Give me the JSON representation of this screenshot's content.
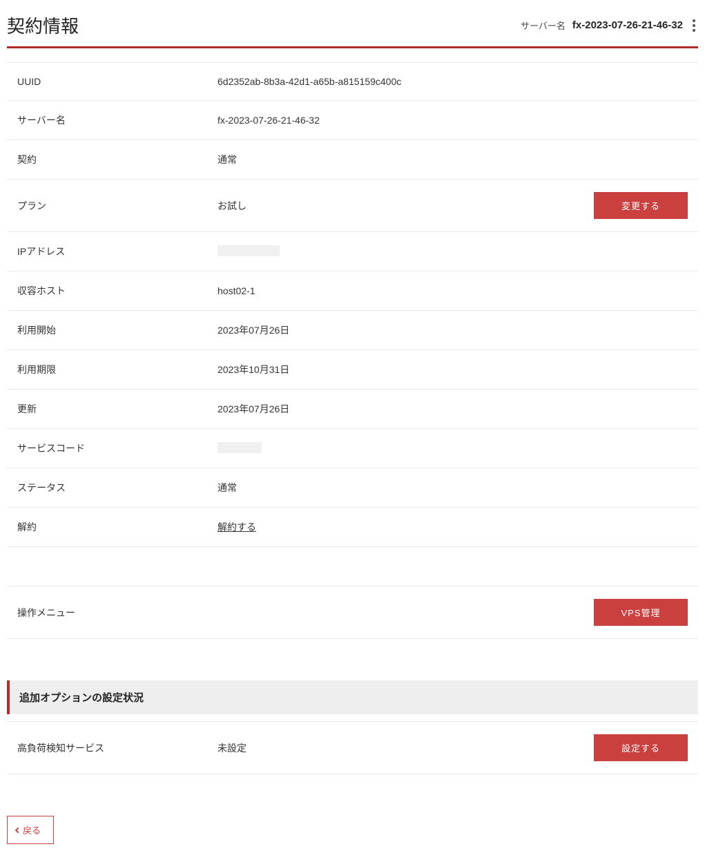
{
  "header": {
    "title": "契約情報",
    "server_label": "サーバー名",
    "server_name": "fx-2023-07-26-21-46-32"
  },
  "rows": {
    "uuid": {
      "label": "UUID",
      "value": "6d2352ab-8b3a-42d1-a65b-a815159c400c"
    },
    "server": {
      "label": "サーバー名",
      "value": "fx-2023-07-26-21-46-32"
    },
    "contract": {
      "label": "契約",
      "value": "通常"
    },
    "plan": {
      "label": "プラン",
      "value": "お試し",
      "action": "変更する"
    },
    "ip": {
      "label": "IPアドレス"
    },
    "host": {
      "label": "収容ホスト",
      "value": "host02-1"
    },
    "start": {
      "label": "利用開始",
      "value": "2023年07月26日"
    },
    "end": {
      "label": "利用期限",
      "value": "2023年10月31日"
    },
    "update": {
      "label": "更新",
      "value": "2023年07月26日"
    },
    "svccode": {
      "label": "サービスコード"
    },
    "status": {
      "label": "ステータス",
      "value": "通常"
    },
    "cancel": {
      "label": "解約",
      "link": "解約する"
    },
    "opmenu": {
      "label": "操作メニュー",
      "action": "VPS管理"
    }
  },
  "section": {
    "title": "追加オプションの設定状況",
    "highload": {
      "label": "高負荷検知サービス",
      "value": "未設定",
      "action": "設定する"
    }
  },
  "back": {
    "label": "戻る"
  }
}
